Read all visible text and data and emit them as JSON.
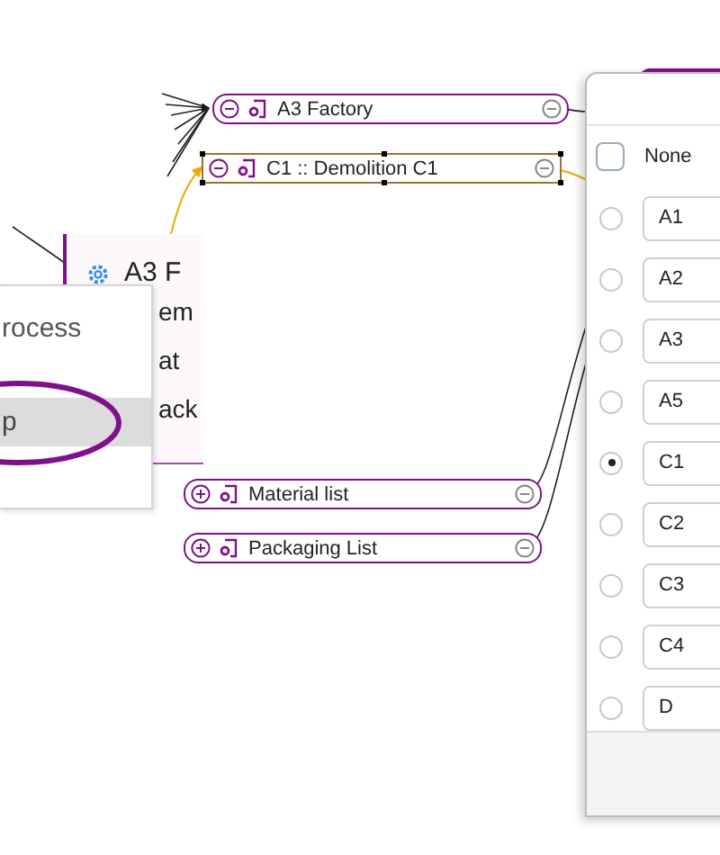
{
  "canvas": {
    "nodes": [
      {
        "label": "A3 Factory",
        "expanded": true,
        "selected": false
      },
      {
        "label": "C1 :: Demolition C1",
        "expanded": true,
        "selected": true
      },
      {
        "label": "Material list",
        "expanded": false,
        "selected": false
      },
      {
        "label": "Packaging List",
        "expanded": false,
        "selected": false
      }
    ],
    "process_card": {
      "title": "A3 F",
      "lines": [
        "em",
        "at",
        "ack"
      ]
    },
    "context_menu": {
      "items": [
        {
          "label": "rocess",
          "selected": false
        },
        {
          "label": "p",
          "selected": true
        }
      ]
    }
  },
  "dialog": {
    "options": [
      {
        "label": "None",
        "selected": false,
        "kind": "plain"
      },
      {
        "label": "A1",
        "selected": false,
        "kind": "field"
      },
      {
        "label": "A2",
        "selected": false,
        "kind": "field"
      },
      {
        "label": "A3",
        "selected": false,
        "kind": "field"
      },
      {
        "label": "A5",
        "selected": false,
        "kind": "field"
      },
      {
        "label": "C1",
        "selected": true,
        "kind": "field"
      },
      {
        "label": "C2",
        "selected": false,
        "kind": "field"
      },
      {
        "label": "C3",
        "selected": false,
        "kind": "field"
      },
      {
        "label": "C4",
        "selected": false,
        "kind": "field"
      },
      {
        "label": "D",
        "selected": false,
        "kind": "field"
      }
    ]
  }
}
